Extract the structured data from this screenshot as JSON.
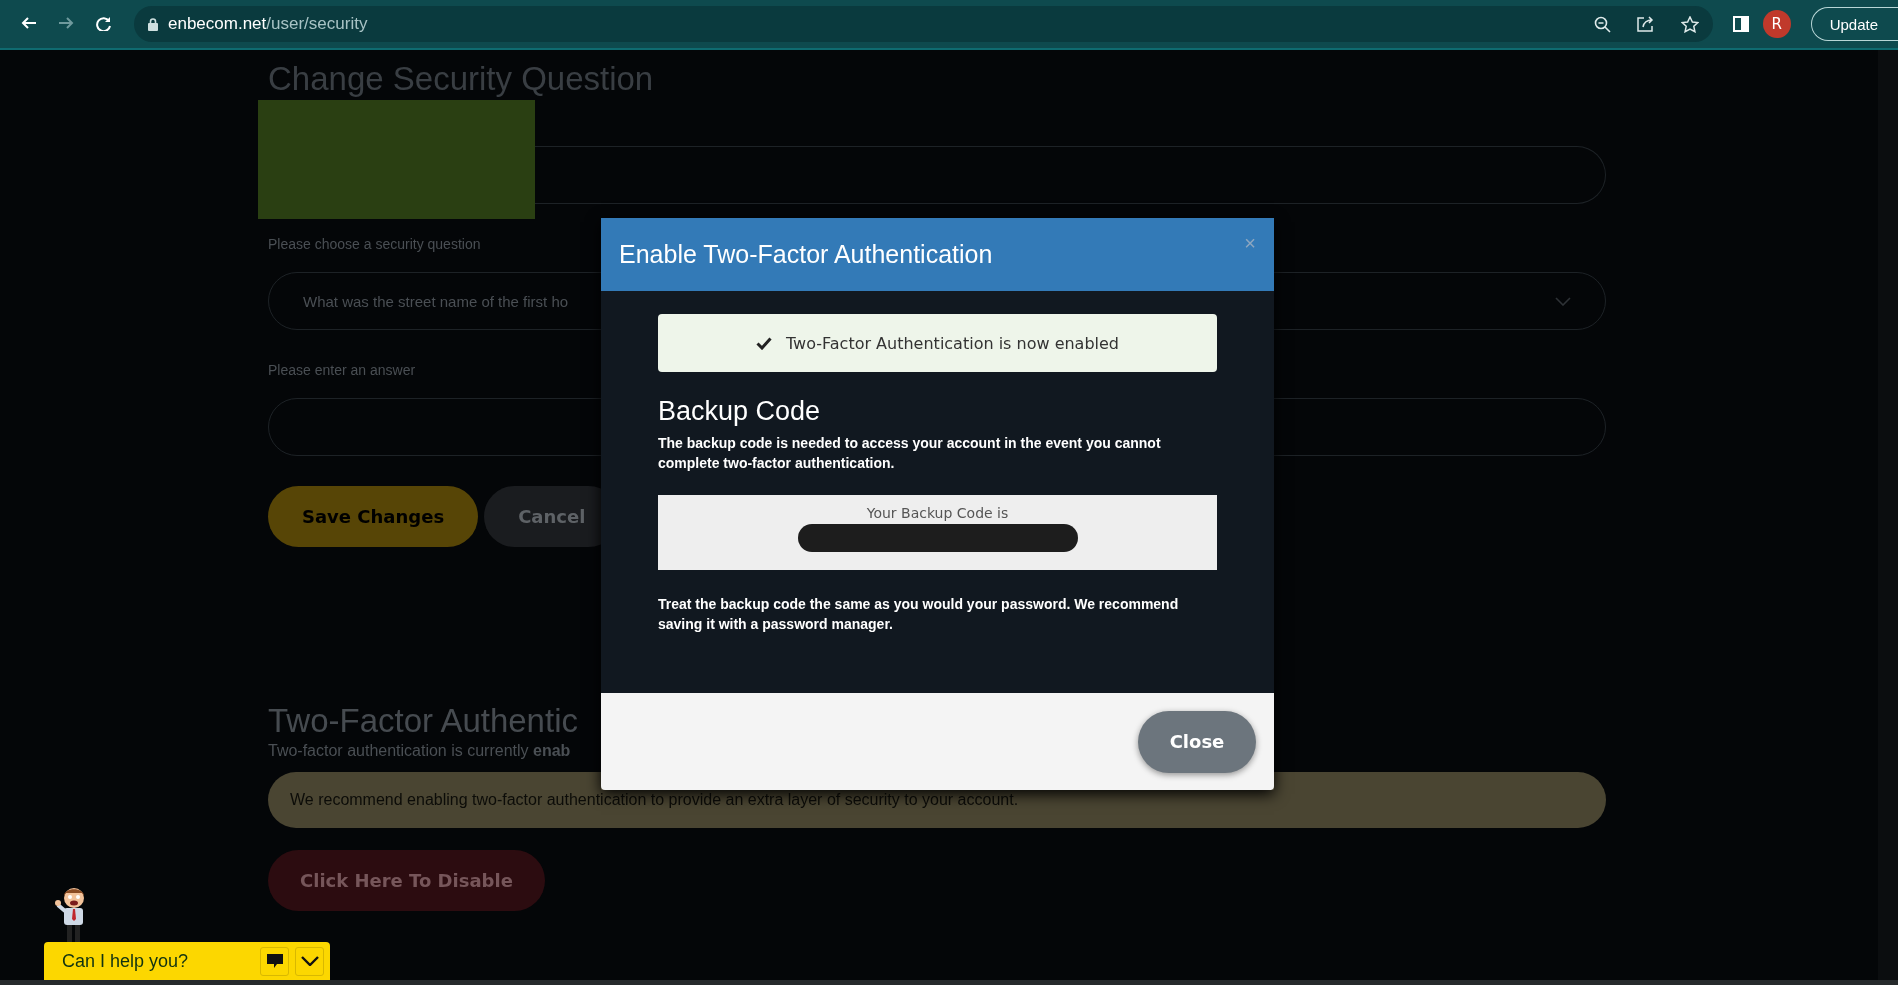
{
  "browser": {
    "nav": [
      {
        "kind": "back",
        "disabled": false
      },
      {
        "kind": "forward",
        "disabled": true
      },
      {
        "kind": "reload",
        "disabled": false
      }
    ],
    "url_host": "enbecom.net",
    "url_path": "/user/security",
    "profile_initial": "R",
    "update_button": "Update"
  },
  "security_question": {
    "title": "Change Security Question",
    "question_label": "Please choose a security question",
    "question_value": "What was the street name of the first ho",
    "answer_label": "Please enter an answer",
    "buttons": [
      {
        "kind": "primary",
        "label": "Save Changes"
      },
      {
        "kind": "secondary",
        "label": "Cancel"
      }
    ]
  },
  "two_factor": {
    "title": "Two-Factor Authentic",
    "status": "Two-factor authentication is currently **enab**",
    "alert": "We recommend enabling two-factor authentication to provide an extra layer of security to your account.",
    "disable_button": "Click Here To Disable"
  },
  "modal": {
    "title": "Enable Two-Factor Authentication",
    "close_glyph": "×",
    "success": "Two-Factor Authentication is now enabled",
    "backup_heading": "Backup Code",
    "description": "The backup code is needed to access your account in the event you cannot complete two-factor authentication.",
    "code_label": "Your Backup Code is",
    "advice": "Treat the backup code the same as you would your password. We recommend saving it with a password manager.",
    "close_button": "Close"
  },
  "chat": {
    "prompt": "Can I help you?"
  }
}
